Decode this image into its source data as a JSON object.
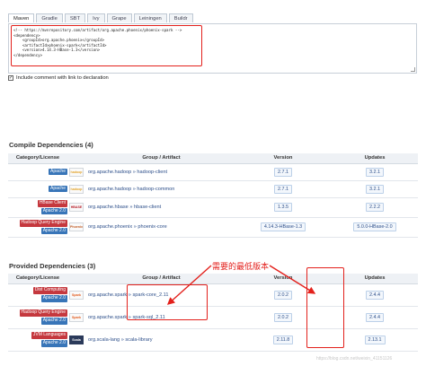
{
  "tabs": [
    "Maven",
    "Gradle",
    "SBT",
    "Ivy",
    "Grape",
    "Leiningen",
    "Buildr"
  ],
  "code_lines": [
    "<!-- https://mvnrepository.com/artifact/org.apache.phoenix/phoenix-spark -->",
    "<dependency>",
    "    <groupId>org.apache.phoenix</groupId>",
    "    <artifactId>phoenix-spark</artifactId>",
    "    <version>4.14.3-HBase-1.3</version>",
    "</dependency>"
  ],
  "include_comment": {
    "checked": true,
    "label": "Include comment with link to declaration"
  },
  "compile": {
    "title": "Compile Dependencies (4)",
    "headers": [
      "Category/License",
      "Group / Artifact",
      "Version",
      "Updates"
    ],
    "rows": [
      {
        "badges": [
          {
            "text": "Apache",
            "color": "#3875b8"
          }
        ],
        "logo": "hadoop-logo",
        "logo_text": "hadoop",
        "artifact": "org.apache.hadoop » hadoop-client",
        "version": "2.7.1",
        "update": "3.2.1"
      },
      {
        "badges": [
          {
            "text": "Apache",
            "color": "#3875b8"
          }
        ],
        "logo": "hadoop-logo",
        "logo_text": "hadoop",
        "artifact": "org.apache.hadoop » hadoop-common",
        "version": "2.7.1",
        "update": "3.2.1"
      },
      {
        "badges": [
          {
            "text": "HBase Client",
            "color": "#c5383e"
          },
          {
            "text": "Apache 2.0",
            "color": "#3875b8"
          }
        ],
        "logo": "hbase-logo",
        "logo_text": "HBASE",
        "artifact": "org.apache.hbase » hbase-client",
        "version": "1.3.5",
        "update": "2.2.2"
      },
      {
        "badges": [
          {
            "text": "Hadoop Query Engine",
            "color": "#c5383e"
          },
          {
            "text": "Apache 2.0",
            "color": "#3875b8"
          }
        ],
        "logo": "phoenix-logo",
        "logo_text": "Phoenix",
        "artifact": "org.apache.phoenix » phoenix-core",
        "version": "4.14.3-HBase-1.3",
        "update": "5.0.0-HBase-2.0"
      }
    ]
  },
  "provided": {
    "title": "Provided Dependencies (3)",
    "headers": [
      "Category/License",
      "Group / Artifact",
      "Version",
      "Updates"
    ],
    "rows": [
      {
        "badges": [
          {
            "text": "Dist Computing",
            "color": "#c5383e"
          },
          {
            "text": "Apache 2.0",
            "color": "#3875b8"
          }
        ],
        "logo": "spark-logo",
        "logo_text": "Spark",
        "artifact": "org.apache.spark » spark-core_2.11",
        "version": "2.0.2",
        "update": "2.4.4"
      },
      {
        "badges": [
          {
            "text": "Hadoop Query Engine",
            "color": "#c5383e"
          },
          {
            "text": "Apache 2.0",
            "color": "#3875b8"
          }
        ],
        "logo": "spark-logo",
        "logo_text": "Spark",
        "artifact": "org.apache.spark » spark-sql_2.11",
        "version": "2.0.2",
        "update": "2.4.4"
      },
      {
        "badges": [
          {
            "text": "JVM Languages",
            "color": "#c5383e"
          },
          {
            "text": "Apache 2.0",
            "color": "#3875b8"
          }
        ],
        "logo": "scala-logo",
        "logo_text": "Scala",
        "artifact": "org.scala-lang » scala-library",
        "version": "2.11.8",
        "update": "2.13.1"
      }
    ]
  },
  "annotation": {
    "text": "需要的最低版本",
    "color": "#e3211c"
  },
  "watermark": "https://blog.csdn.net/weixin_41151126"
}
